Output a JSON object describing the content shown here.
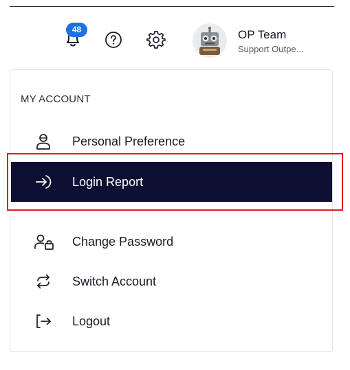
{
  "header": {
    "notifications_count": "48",
    "profile": {
      "name": "OP Team",
      "subtitle": "Support Outpe..."
    }
  },
  "menu": {
    "section_title": "MY ACCOUNT",
    "items": [
      {
        "label": "Personal Preference",
        "icon": "user-icon",
        "active": false
      },
      {
        "label": "Login Report",
        "icon": "login-arrow-icon",
        "active": true
      },
      {
        "label": "Change Password",
        "icon": "user-lock-icon",
        "active": false
      },
      {
        "label": "Switch Account",
        "icon": "switch-arrows-icon",
        "active": false
      },
      {
        "label": "Logout",
        "icon": "logout-icon",
        "active": false
      }
    ]
  },
  "colors": {
    "active_bg": "#0d1033",
    "badge": "#1f6fe5",
    "highlight_border": "#e11b1b"
  }
}
